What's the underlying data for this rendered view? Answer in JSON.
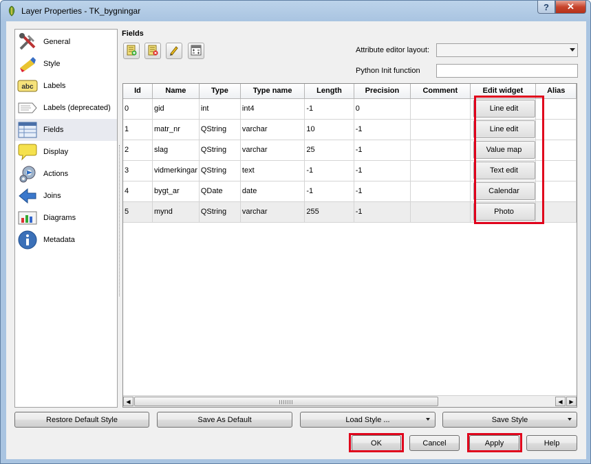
{
  "window": {
    "title": "Layer Properties - TK_bygningar",
    "help_glyph": "?",
    "close_glyph": "✕"
  },
  "sidebar": {
    "items": [
      {
        "label": "General",
        "icon": "general-icon"
      },
      {
        "label": "Style",
        "icon": "style-icon"
      },
      {
        "label": "Labels",
        "icon": "labels-icon"
      },
      {
        "label": "Labels (deprecated)",
        "icon": "labels-deprecated-icon"
      },
      {
        "label": "Fields",
        "icon": "fields-icon"
      },
      {
        "label": "Display",
        "icon": "display-icon"
      },
      {
        "label": "Actions",
        "icon": "actions-icon"
      },
      {
        "label": "Joins",
        "icon": "joins-icon"
      },
      {
        "label": "Diagrams",
        "icon": "diagrams-icon"
      },
      {
        "label": "Metadata",
        "icon": "metadata-icon"
      }
    ],
    "selected": "Fields",
    "labels_icon_text": "abc"
  },
  "fields": {
    "heading": "Fields",
    "attribute_editor_layout_label": "Attribute editor layout:",
    "attribute_editor_layout_value": "",
    "python_init_label": "Python Init function",
    "python_init_value": ""
  },
  "table": {
    "columns": [
      "Id",
      "Name",
      "Type",
      "Type name",
      "Length",
      "Precision",
      "Comment",
      "Edit widget",
      "Alias"
    ],
    "rows": [
      {
        "id": "0",
        "name": "gid",
        "type": "int",
        "type_name": "int4",
        "length": "-1",
        "precision": "0",
        "comment": "",
        "widget": "Line edit",
        "alias": ""
      },
      {
        "id": "1",
        "name": "matr_nr",
        "type": "QString",
        "type_name": "varchar",
        "length": "10",
        "precision": "-1",
        "comment": "",
        "widget": "Line edit",
        "alias": ""
      },
      {
        "id": "2",
        "name": "slag",
        "type": "QString",
        "type_name": "varchar",
        "length": "25",
        "precision": "-1",
        "comment": "",
        "widget": "Value map",
        "alias": ""
      },
      {
        "id": "3",
        "name": "vidmerkingar",
        "type": "QString",
        "type_name": "text",
        "length": "-1",
        "precision": "-1",
        "comment": "",
        "widget": "Text edit",
        "alias": ""
      },
      {
        "id": "4",
        "name": "bygt_ar",
        "type": "QDate",
        "type_name": "date",
        "length": "-1",
        "precision": "-1",
        "comment": "",
        "widget": "Calendar",
        "alias": ""
      },
      {
        "id": "5",
        "name": "mynd",
        "type": "QString",
        "type_name": "varchar",
        "length": "255",
        "precision": "-1",
        "comment": "",
        "widget": "Photo",
        "alias": ""
      }
    ]
  },
  "buttons": {
    "restore_default_style": "Restore Default Style",
    "save_as_default": "Save As Default",
    "load_style": "Load Style ...",
    "save_style": "Save Style",
    "ok": "OK",
    "cancel": "Cancel",
    "apply": "Apply",
    "help": "Help"
  },
  "colors": {
    "highlight": "#e0001b",
    "selected_sidebar": "#e8eaf0"
  }
}
